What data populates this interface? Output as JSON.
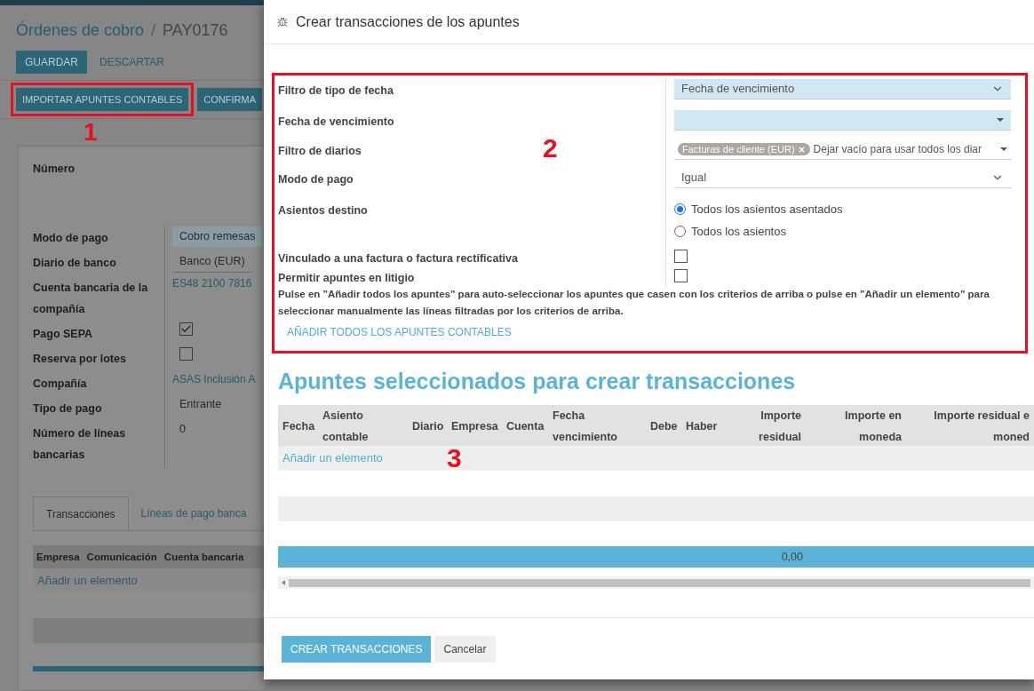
{
  "background_page": {
    "breadcrumb": {
      "parent": "Órdenes de cobro",
      "separator": "/",
      "current": "PAY0176"
    },
    "buttons": [
      {
        "label": "GUARDAR",
        "kind": "primary"
      },
      {
        "label": "DESCARTAR",
        "kind": "link"
      }
    ],
    "actions": [
      {
        "label": "IMPORTAR APUNTES CONTABLES",
        "highlighted": true
      },
      {
        "label": "CONFIRMA",
        "highlighted": false
      }
    ],
    "annotation": "1",
    "number_label": "Número",
    "fields": [
      {
        "label": "Modo de pago",
        "kind": "select",
        "value": "Cobro remesas"
      },
      {
        "label": "Diario de banco",
        "kind": "input",
        "value": "Banco (EUR)"
      },
      {
        "label": "Cuenta bancaria de la compañía",
        "kind": "link",
        "value": "ES48 2100 7816"
      },
      {
        "label": "Pago SEPA",
        "kind": "checkbox",
        "checked": true
      },
      {
        "label": "Reserva por lotes",
        "kind": "checkbox",
        "checked": false
      },
      {
        "label": "Compañía",
        "kind": "link",
        "value": "ASAS Inclusión A"
      },
      {
        "label": "Tipo de pago",
        "kind": "text",
        "value": "Entrante"
      },
      {
        "label": "Número de líneas bancarias",
        "kind": "text",
        "value": "0"
      }
    ],
    "tabs": [
      {
        "label": "Transacciones",
        "selected": true
      },
      {
        "label": "Líneas de pago banca",
        "selected": false
      }
    ],
    "table": {
      "columns": [
        "Empresa",
        "Comunicación",
        "Cuenta bancaria"
      ],
      "add_line": "Añadir un elemento"
    }
  },
  "dialog": {
    "title": "Crear transacciones de los apuntes",
    "filter": {
      "annotation": "2",
      "fields": [
        {
          "label": "Filtro de tipo de fecha",
          "kind": "select",
          "value": "Fecha de vencimiento",
          "required": true
        },
        {
          "label": "Fecha de vencimiento",
          "kind": "date",
          "required": true
        },
        {
          "label": "Filtro de diarios",
          "kind": "tags",
          "tags": [
            "Facturas de cliente (EUR)"
          ],
          "placeholder": "Dejar vacío para usar todos los diar"
        },
        {
          "label": "Modo de pago",
          "kind": "select",
          "value": "Igual",
          "required": false
        },
        {
          "label": "Asientos destino",
          "kind": "radio",
          "options": [
            {
              "label": "Todos los asientos asentados",
              "selected": true
            },
            {
              "label": "Todos los asientos",
              "selected": false
            }
          ]
        },
        {
          "label": "Vinculado a una factura o factura rectificativa",
          "kind": "checkbox",
          "checked": false
        },
        {
          "label": "Permitir apuntes en litigio",
          "kind": "checkbox",
          "checked": false
        }
      ],
      "help": "Pulse en \"Añadir todos los apuntes\" para auto-seleccionar los apuntes que casen con los criterios de arriba o pulse en \"Añadir un elemento\" para seleccionar manualmente las líneas filtradas por los criterios de arriba.",
      "add_all": "AÑADIR TODOS LOS APUNTES CONTABLES"
    },
    "section_title": "Apuntes seleccionados para crear transacciones",
    "table": {
      "columns": [
        "Fecha",
        "Asiento contable",
        "Diario",
        "Empresa",
        "Cuenta",
        "Fecha vencimiento",
        "Debe",
        "Haber",
        "Importe residual",
        "Importe en moneda",
        "Importe residual e\nmoned"
      ],
      "add_line": "Añadir un elemento",
      "annotation": "3",
      "total": "0,00"
    },
    "buttons": [
      {
        "label": "CREAR TRANSACCIONES",
        "kind": "primary"
      },
      {
        "label": "Cancelar",
        "kind": "secondary"
      }
    ]
  }
}
